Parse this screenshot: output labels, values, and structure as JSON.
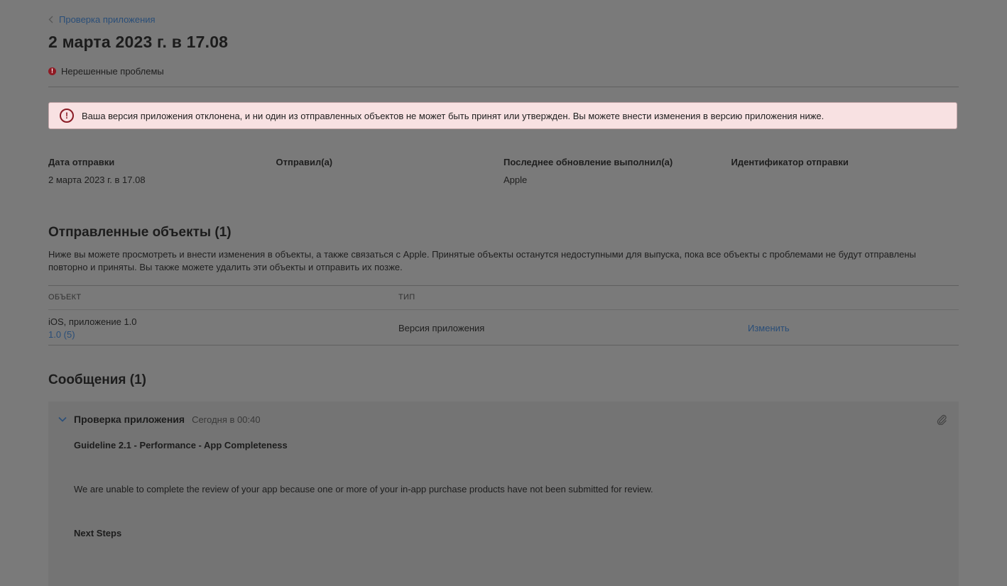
{
  "breadcrumb": {
    "label": "Проверка приложения"
  },
  "page_title": "2 марта 2023 г. в 17.08",
  "status": {
    "label": "Нерешенные проблемы",
    "icon": "!"
  },
  "alert": {
    "icon": "!",
    "text": "Ваша версия приложения отклонена, и ни один из отправленных объектов не может быть принят или утвержден. Вы можете внести изменения в версию приложения ниже."
  },
  "meta": [
    {
      "label": "Дата отправки",
      "value": "2 марта 2023 г. в 17.08"
    },
    {
      "label": "Отправил(а)",
      "value": ""
    },
    {
      "label": "Последнее обновление выполнил(а)",
      "value": "Apple"
    },
    {
      "label": "Идентификатор отправки",
      "value": ""
    }
  ],
  "submitted": {
    "title": "Отправленные объекты (1)",
    "description": "Ниже вы можете просмотреть и внести изменения в объекты, а также связаться с Apple. Принятые объекты останутся недоступными для выпуска, пока все объекты с проблемами не будут отправлены повторно и приняты. Вы также можете удалить эти объекты и отправить их позже.",
    "columns": [
      "ОБЪЕКТ",
      "ТИП"
    ],
    "rows": [
      {
        "object": "iOS, приложение 1.0",
        "version": "1.0 (5)",
        "type": "Версия приложения",
        "action": "Изменить"
      }
    ]
  },
  "messages": {
    "title": "Сообщения (1)",
    "items": [
      {
        "sender": "Проверка приложения",
        "time": "Сегодня в 00:40",
        "guideline": "Guideline 2.1 - Performance - App Completeness",
        "body": "We are unable to complete the review of your app because one or more of your in-app purchase products have not been submitted for review.",
        "next_steps": "Next Steps"
      }
    ]
  },
  "colors": {
    "link": "#2a4e78",
    "alert_bg": "#f8e1e2",
    "error": "#8a1b25",
    "overlay": "#7a7a7a"
  }
}
